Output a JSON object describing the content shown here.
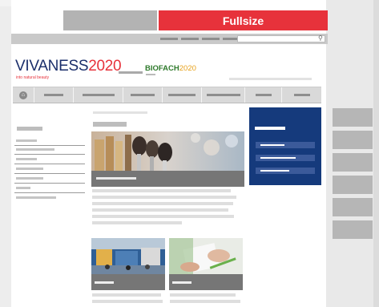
{
  "header": {
    "tab_fullsize_label": "Fullsize"
  },
  "logos": {
    "vivaness_name": "VIVANESS",
    "vivaness_year": "2020",
    "vivaness_tagline": "into natural beauty",
    "biofach_name": "BIOFACH",
    "biofach_year": "2020"
  },
  "icons": {
    "home": "home-icon",
    "search": "search-icon"
  },
  "colors": {
    "accent_red": "#e7323b",
    "brand_blue": "#153a7c",
    "biofach_green": "#2f7a2c"
  }
}
